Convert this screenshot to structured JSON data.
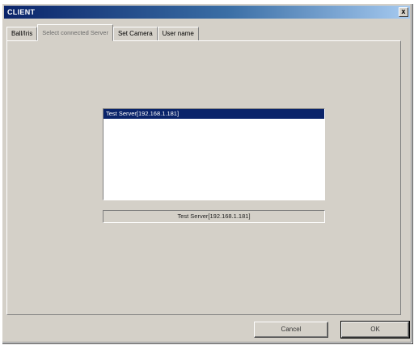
{
  "window": {
    "title": "CLIENT",
    "close_glyph": "x"
  },
  "tabs": [
    {
      "label": "Ball/Iris",
      "active": false
    },
    {
      "label": "Select connected Server",
      "active": true
    },
    {
      "label": "Set Camera",
      "active": false
    },
    {
      "label": "User name",
      "active": false
    }
  ],
  "server_list": {
    "items": [
      {
        "label": "Test Server[192.168.1.181]",
        "selected": true
      }
    ]
  },
  "selected_server_display": "Test Server[192.168.1.181]",
  "buttons": {
    "cancel_label": "Cancel",
    "ok_label": "OK"
  },
  "colors": {
    "titlebar_start": "#0a246a",
    "selection": "#0a246a",
    "dialog_face": "#d4d0c8"
  }
}
